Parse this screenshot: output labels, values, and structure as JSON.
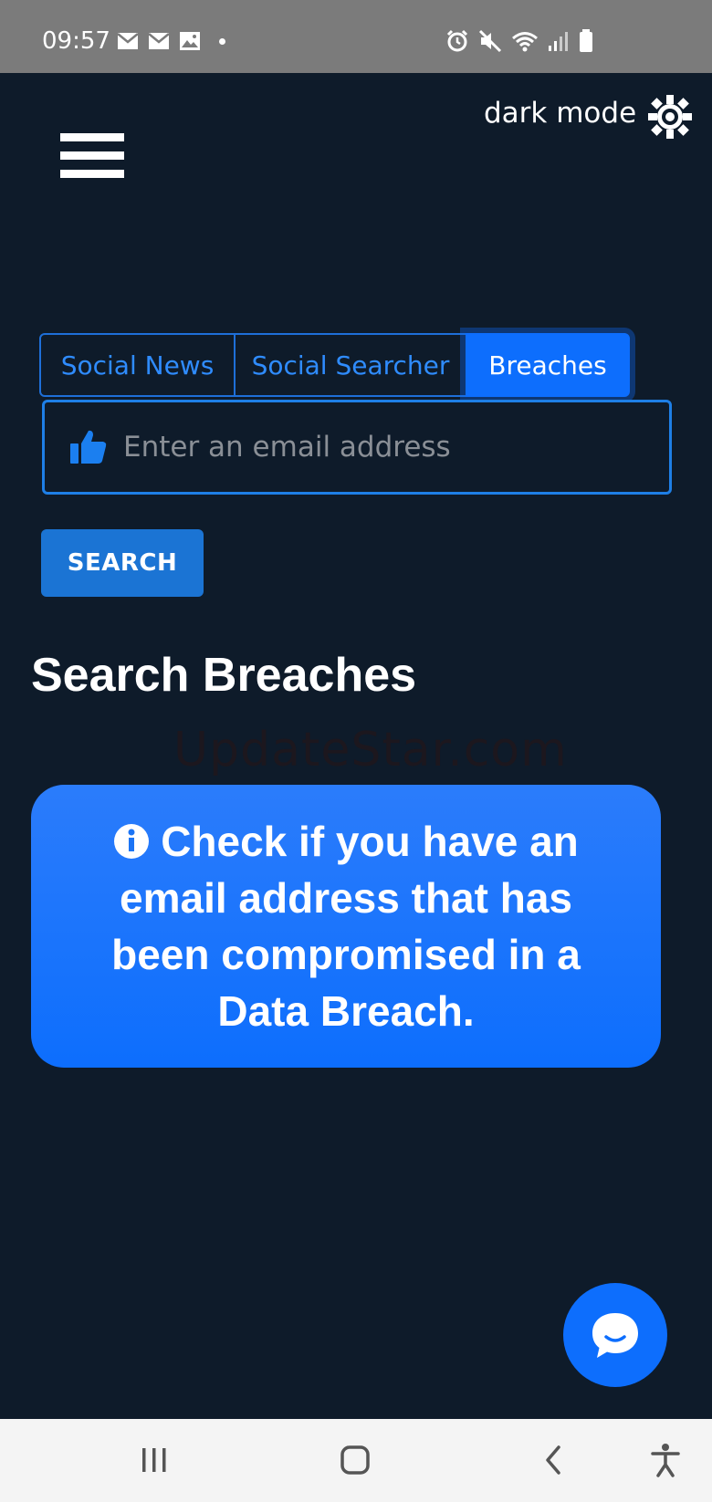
{
  "status_bar": {
    "time": "09:57",
    "left_icons": [
      "mail-icon",
      "mail-icon",
      "image-icon"
    ],
    "right_icons": [
      "alarm-icon",
      "mute-icon",
      "wifi-icon",
      "signal-icon",
      "battery-icon"
    ]
  },
  "header": {
    "dark_mode_label": "dark mode",
    "theme_icon": "brightness-icon",
    "menu_icon": "hamburger-menu-icon"
  },
  "tabs": [
    {
      "label": "Social News",
      "active": false
    },
    {
      "label": "Social Searcher",
      "active": false
    },
    {
      "label": "Breaches",
      "active": true
    }
  ],
  "search": {
    "placeholder": "Enter an email address",
    "value": "",
    "field_icon": "thumbs-up-icon",
    "button_label": "SEARCH"
  },
  "main": {
    "section_title": "Search Breaches",
    "watermark": "UpdateStar.com",
    "info_icon": "info-circle-icon",
    "info_text": "Check if you have an email address that has been compromised in a Data Breach."
  },
  "chat": {
    "icon": "chat-bubble-icon"
  },
  "nav_bar": {
    "icons": [
      "recent-apps-icon",
      "home-icon",
      "back-icon",
      "accessibility-icon"
    ]
  },
  "colors": {
    "background": "#0e1b2a",
    "accent": "#0d6efd",
    "tab_text": "#2f8cff",
    "status_bar": "#7b7b7b",
    "nav_bar": "#f4f4f4"
  }
}
